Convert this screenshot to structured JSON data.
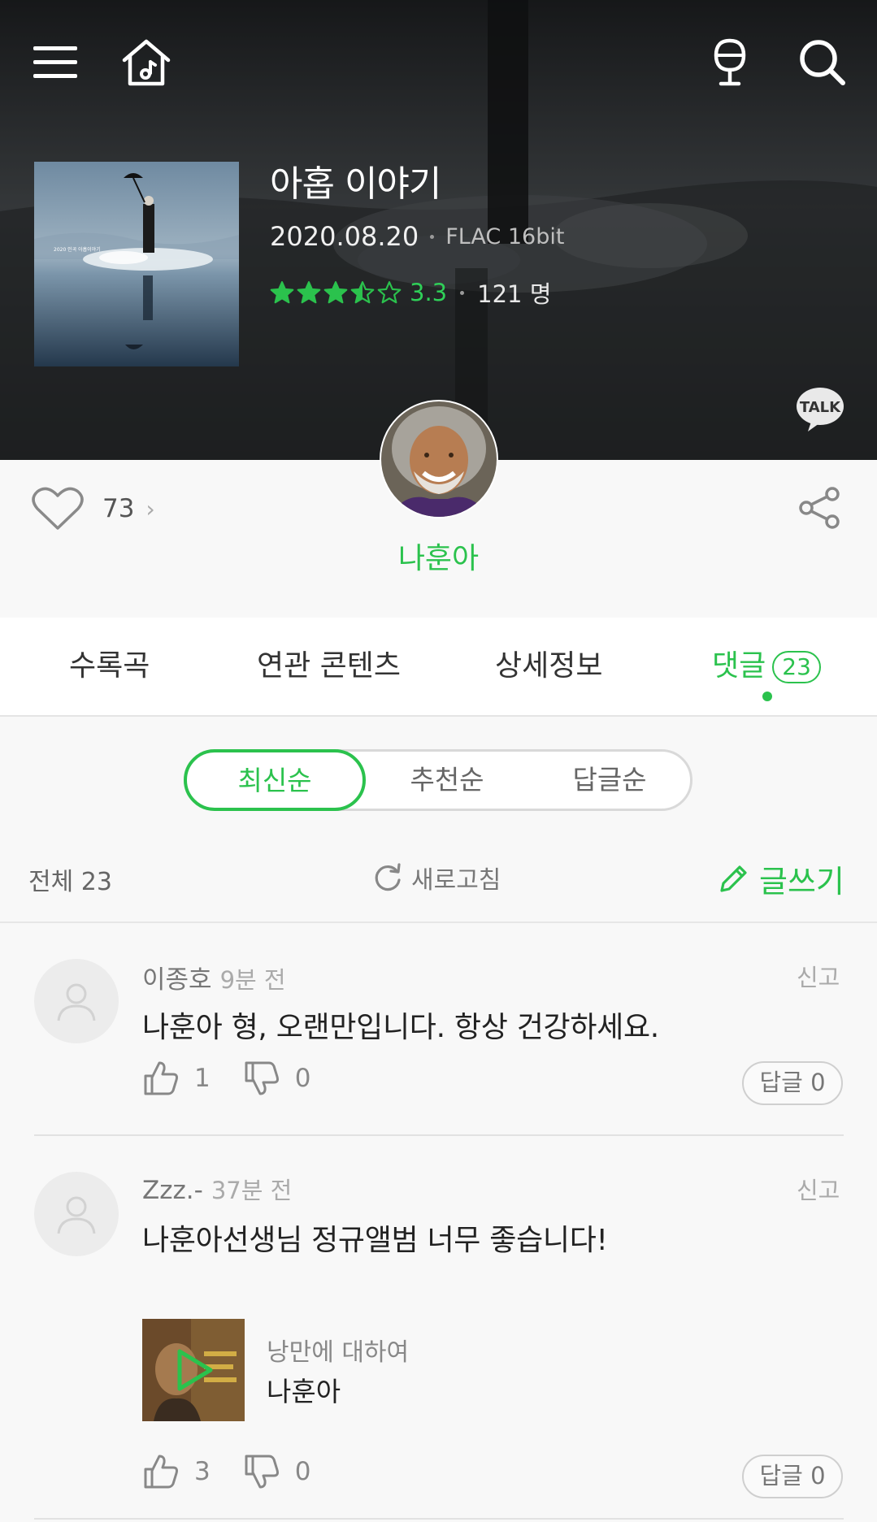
{
  "header": {
    "menu_icon": "menu-icon",
    "home_icon": "music-home-icon",
    "mic_icon": "microphone-icon",
    "search_icon": "search-icon"
  },
  "album": {
    "title": "아홉 이야기",
    "release_date": "2020.08.20",
    "format": "FLAC 16bit",
    "rating_score": "3.3",
    "rating_value": 3.3,
    "rating_count": "121 명",
    "cover_text": "2020 인곡 아홉이야기",
    "talk_label": "TALK"
  },
  "artist": {
    "name": "나훈아"
  },
  "like": {
    "count": "73",
    "chevron": "›"
  },
  "tabs": [
    {
      "label": "수록곡"
    },
    {
      "label": "연관 콘텐츠"
    },
    {
      "label": "상세정보"
    },
    {
      "label": "댓글",
      "badge": "23",
      "active": true
    }
  ],
  "sort": {
    "options": [
      "최신순",
      "추천순",
      "답글순"
    ],
    "selected": "최신순"
  },
  "list": {
    "total_label": "전체 23",
    "refresh_label": "새로고침",
    "write_label": "글쓰기"
  },
  "comments": [
    {
      "user": "이종호",
      "time": "9분 전",
      "report": "신고",
      "text": "나훈아 형, 오랜만입니다. 항상 건강하세요.",
      "likes": "1",
      "dislikes": "0",
      "reply": "답글 0"
    },
    {
      "user": "Zzz.-",
      "time": "37분 전",
      "report": "신고",
      "text": "나훈아선생님 정규앨범 너무 좋습니다!",
      "song": {
        "title": "낭만에 대하여",
        "artist": "나훈아"
      },
      "likes": "3",
      "dislikes": "0",
      "reply": "답글 0"
    }
  ],
  "colors": {
    "accent": "#2bc24d",
    "hero_bg": "#2a2c2e"
  }
}
